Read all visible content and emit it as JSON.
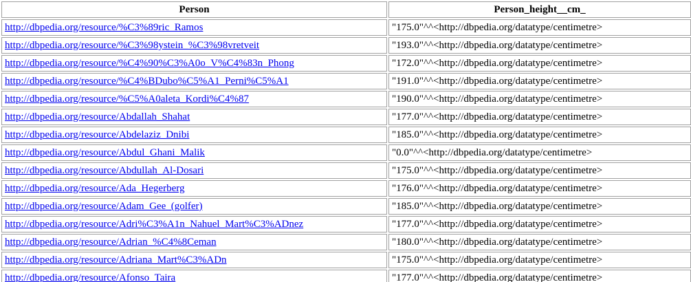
{
  "table": {
    "headers": [
      "Person",
      "Person_height__cm_"
    ],
    "rows": [
      {
        "person": "http://dbpedia.org/resource/%C3%89ric_Ramos",
        "height": "\"175.0\"^^<http://dbpedia.org/datatype/centimetre>"
      },
      {
        "person": "http://dbpedia.org/resource/%C3%98ystein_%C3%98vretveit",
        "height": "\"193.0\"^^<http://dbpedia.org/datatype/centimetre>"
      },
      {
        "person": "http://dbpedia.org/resource/%C4%90%C3%A0o_V%C4%83n_Phong",
        "height": "\"172.0\"^^<http://dbpedia.org/datatype/centimetre>"
      },
      {
        "person": "http://dbpedia.org/resource/%C4%BDubo%C5%A1_Perni%C5%A1",
        "height": "\"191.0\"^^<http://dbpedia.org/datatype/centimetre>"
      },
      {
        "person": "http://dbpedia.org/resource/%C5%A0aleta_Kordi%C4%87",
        "height": "\"190.0\"^^<http://dbpedia.org/datatype/centimetre>"
      },
      {
        "person": "http://dbpedia.org/resource/Abdallah_Shahat",
        "height": "\"177.0\"^^<http://dbpedia.org/datatype/centimetre>"
      },
      {
        "person": "http://dbpedia.org/resource/Abdelaziz_Dnibi",
        "height": "\"185.0\"^^<http://dbpedia.org/datatype/centimetre>"
      },
      {
        "person": "http://dbpedia.org/resource/Abdul_Ghani_Malik",
        "height": "\"0.0\"^^<http://dbpedia.org/datatype/centimetre>"
      },
      {
        "person": "http://dbpedia.org/resource/Abdullah_Al-Dosari",
        "height": "\"175.0\"^^<http://dbpedia.org/datatype/centimetre>"
      },
      {
        "person": "http://dbpedia.org/resource/Ada_Hegerberg",
        "height": "\"176.0\"^^<http://dbpedia.org/datatype/centimetre>"
      },
      {
        "person": "http://dbpedia.org/resource/Adam_Gee_(golfer)",
        "height": "\"185.0\"^^<http://dbpedia.org/datatype/centimetre>"
      },
      {
        "person": "http://dbpedia.org/resource/Adri%C3%A1n_Nahuel_Mart%C3%ADnez",
        "height": "\"177.0\"^^<http://dbpedia.org/datatype/centimetre>"
      },
      {
        "person": "http://dbpedia.org/resource/Adrian_%C4%8Ceman",
        "height": "\"180.0\"^^<http://dbpedia.org/datatype/centimetre>"
      },
      {
        "person": "http://dbpedia.org/resource/Adriana_Mart%C3%ADn",
        "height": "\"175.0\"^^<http://dbpedia.org/datatype/centimetre>"
      },
      {
        "person": "http://dbpedia.org/resource/Afonso_Taira",
        "height": "\"177.0\"^^<http://dbpedia.org/datatype/centimetre>"
      }
    ]
  },
  "colors": {
    "link": "#0000ee",
    "border": "#a0a0a0",
    "background": "#ffffff"
  }
}
